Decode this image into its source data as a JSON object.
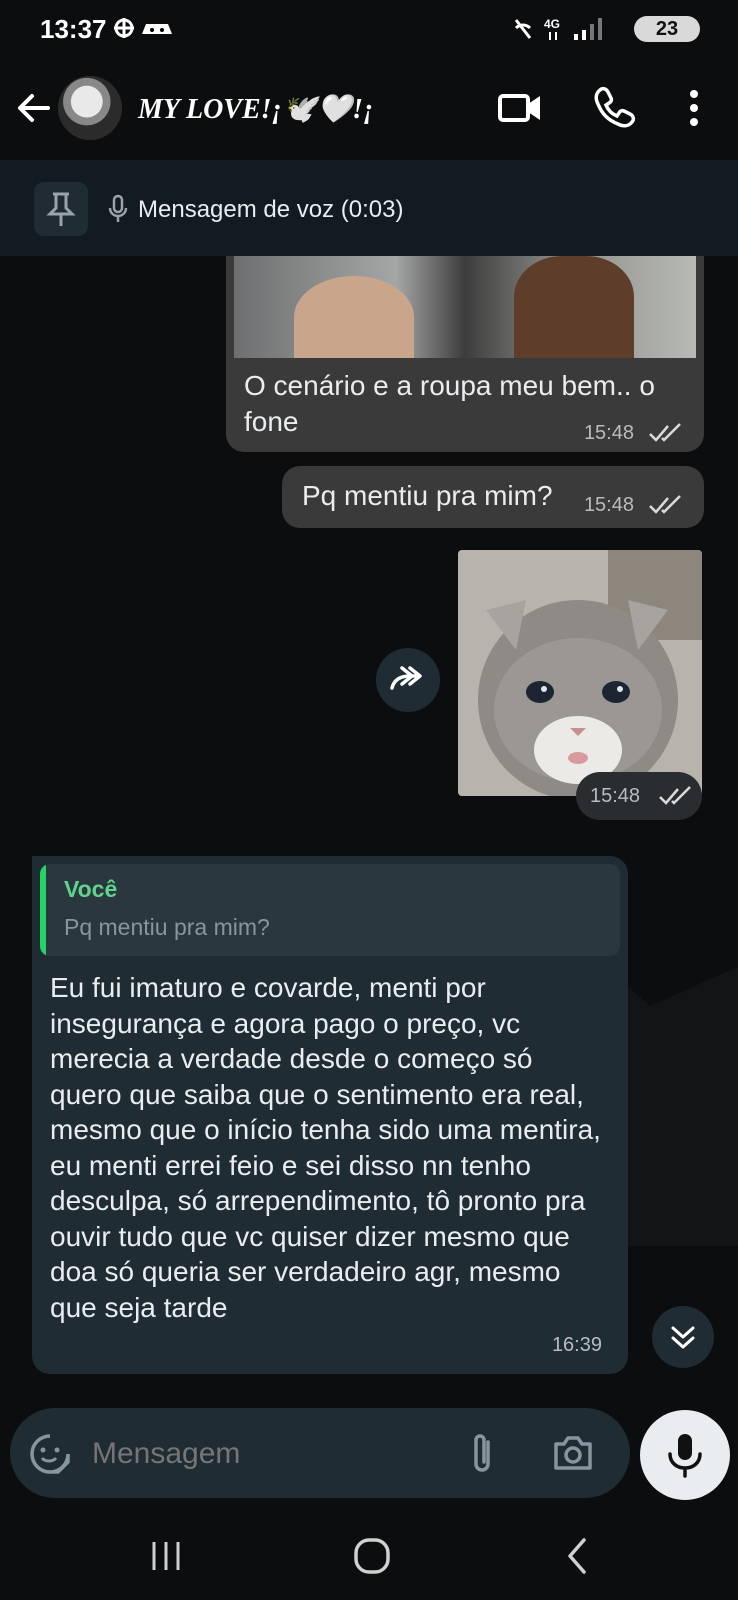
{
  "status_bar": {
    "time": "13:37",
    "network": "4G",
    "battery": "23"
  },
  "header": {
    "contact_name": "MY LOVE!¡🕊️🤍!¡"
  },
  "pinned": {
    "label": "Mensagem de voz (0:03)"
  },
  "messages": [
    {
      "direction": "out",
      "type": "image-text",
      "text": "O cenário e a roupa meu bem.. o fone",
      "time": "15:48"
    },
    {
      "direction": "out",
      "type": "text",
      "text": "Pq mentiu pra mim?",
      "time": "15:48"
    },
    {
      "direction": "out",
      "type": "image",
      "time": "15:48"
    },
    {
      "direction": "in",
      "type": "reply",
      "reply_author": "Você",
      "reply_text": "Pq mentiu pra mim?",
      "text": "Eu fui imaturo e covarde, menti por insegurança e agora pago o preço, vc merecia a verdade desde o começo só quero que saiba que o sentimento era real, mesmo que o início tenha sido uma mentira, eu menti errei feio e sei disso nn tenho desculpa, só arrependimento, tô pronto pra ouvir tudo que vc quiser dizer mesmo que doa só queria ser verdadeiro agr, mesmo que seja tarde",
      "time": "16:39"
    }
  ],
  "input": {
    "placeholder": "Mensagem"
  },
  "colors": {
    "outgoing_bubble": "#3a3a3a",
    "incoming_bubble": "#1f2c33",
    "reply_accent": "#25d366"
  }
}
